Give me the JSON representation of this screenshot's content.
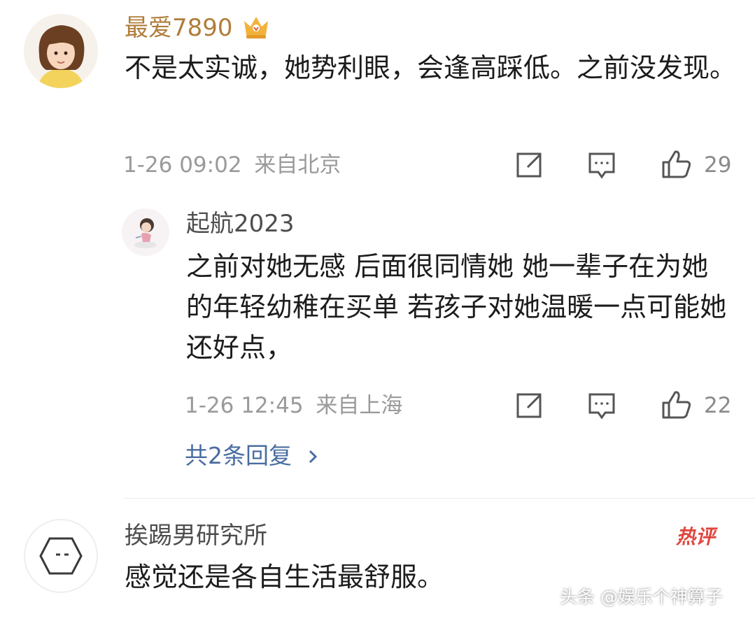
{
  "comments": [
    {
      "username": "最爱7890",
      "text": "不是太实诚，她势利眼，会逢高踩低。之前没发现。",
      "time": "1-26 09:02",
      "location": "来自北京",
      "likes": "29",
      "reply": {
        "username": "起航2023",
        "text": "之前对她无感 后面很同情她 她一辈子在为她的年轻幼稚在买单 若孩子对她温暖一点可能她还好点，",
        "time": "1-26 12:45",
        "location": "来自上海",
        "likes": "22"
      },
      "replies_link": "共2条回复"
    },
    {
      "username": "挨踢男研究所",
      "text": "感觉还是各自生活最舒服。",
      "badge": "热评"
    }
  ],
  "watermark": "头条 @娱乐个神算子",
  "colors": {
    "username": "#b07d3a",
    "link": "#4a6da0",
    "meta": "#9a9a9a",
    "hot": "#e0463e"
  },
  "icons": [
    "vip-crown-icon",
    "share-icon",
    "comment-icon",
    "like-icon",
    "chevron-right-icon"
  ]
}
